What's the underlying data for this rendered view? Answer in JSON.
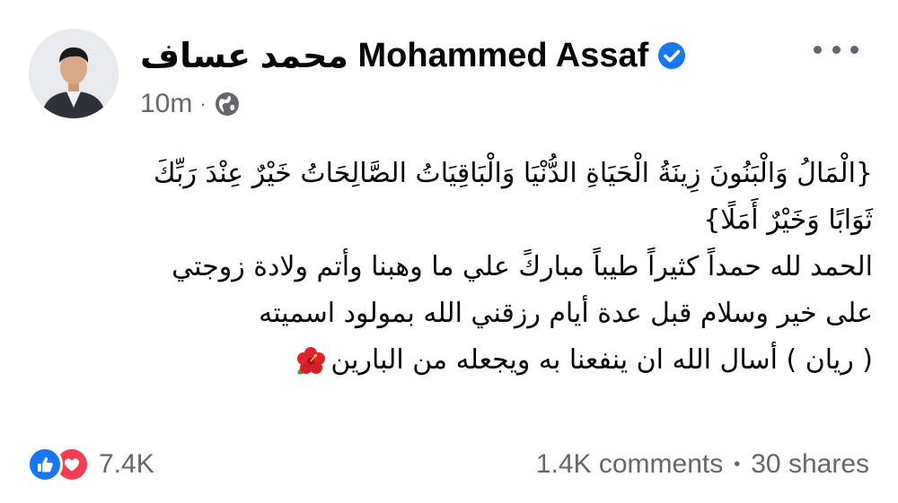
{
  "post": {
    "author_name": "Mohammed Assaf",
    "author_name_arabic": "محمد عساف",
    "timestamp": "10m",
    "audience_icon": "globe-icon",
    "verified_icon": "verified-badge-icon",
    "menu_icon": "more-options-icon",
    "body_lines": [
      "{الْمَالُ وَالْبَنُونَ زِينَةُ الْحَيَاةِ الدُّنْيَا وَالْبَاقِيَاتُ الصَّالِحَاتُ خَيْرٌ عِنْدَ رَبِّكَ",
      "ثَوَابًا وَخَيْرٌ أَمَلًا}",
      "الحمد لله حمداً كثيراً طيباً مباركً علي ما وهبنا وأتم ولادة زوجتي",
      "على خير وسلام  قبل عدة أيام رزقني الله بمولود اسميته",
      "( ريان ) أسال الله ان ينفعنا به ويجعله من البارين"
    ],
    "emoji_icon": "hibiscus-flower-icon"
  },
  "footer": {
    "reaction_icons": [
      "like-icon",
      "love-icon"
    ],
    "reaction_count": "7.4K",
    "comments": "1.4K comments",
    "separator": "•",
    "shares": "30 shares"
  },
  "colors": {
    "text_primary": "#050505",
    "text_secondary": "#65676b",
    "verified_blue": "#1877f2",
    "like_blue": "#1877f2",
    "love_red": "#f33e58",
    "flower_red": "#e0232e"
  }
}
